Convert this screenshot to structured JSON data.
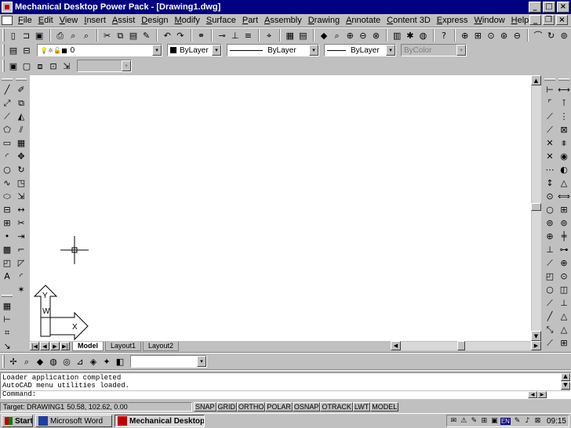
{
  "window": {
    "title": "Mechanical Desktop Power Pack - [Drawing1.dwg]",
    "minimize_glyph": "_",
    "maximize_glyph": "□",
    "close_glyph": "×",
    "mdi_minimize_glyph": "_",
    "mdi_restore_glyph": "❐",
    "mdi_close_glyph": "×"
  },
  "menu": {
    "items": [
      "File",
      "Edit",
      "View",
      "Insert",
      "Assist",
      "Design",
      "Modify",
      "Surface",
      "Part",
      "Assembly",
      "Drawing",
      "Annotate",
      "Content 3D",
      "Express",
      "Window",
      "Help"
    ]
  },
  "standard_toolbar": {
    "icons": [
      {
        "name": "new-icon",
        "glyph": "▯"
      },
      {
        "name": "open-icon",
        "glyph": "⊐"
      },
      {
        "name": "save-icon",
        "glyph": "▣"
      },
      {
        "name": "sep"
      },
      {
        "name": "print-icon",
        "glyph": "⎙"
      },
      {
        "name": "print-preview-icon",
        "glyph": "⌕"
      },
      {
        "name": "find-icon",
        "glyph": "⌕"
      },
      {
        "name": "sep"
      },
      {
        "name": "cut-icon",
        "glyph": "✂"
      },
      {
        "name": "copy-icon",
        "glyph": "⧉"
      },
      {
        "name": "paste-icon",
        "glyph": "▤"
      },
      {
        "name": "match-properties-icon",
        "glyph": "✎"
      },
      {
        "name": "sep"
      },
      {
        "name": "undo-icon",
        "glyph": "↶"
      },
      {
        "name": "redo-icon",
        "glyph": "↷"
      },
      {
        "name": "sep"
      },
      {
        "name": "hyperlink-icon",
        "glyph": "⚭"
      },
      {
        "name": "sep"
      },
      {
        "name": "snap-from-icon",
        "glyph": "⊸"
      },
      {
        "name": "ucs-icon",
        "glyph": "⊥"
      },
      {
        "name": "tracking-icon",
        "glyph": "≡"
      },
      {
        "name": "sep"
      },
      {
        "name": "distance-icon",
        "glyph": "⌖"
      },
      {
        "name": "sep"
      },
      {
        "name": "design-center-icon",
        "glyph": "▦"
      },
      {
        "name": "properties-icon",
        "glyph": "▤"
      },
      {
        "name": "sep"
      },
      {
        "name": "view-icon",
        "glyph": "◆"
      },
      {
        "name": "zoom-realtime-icon",
        "glyph": "⌕"
      },
      {
        "name": "zoom-window-icon",
        "glyph": "⊕"
      },
      {
        "name": "zoom-previous-icon",
        "glyph": "⊖"
      },
      {
        "name": "zoom-all-icon",
        "glyph": "⊗"
      },
      {
        "name": "sep"
      },
      {
        "name": "layer-icon",
        "glyph": "▥"
      },
      {
        "name": "linetype-icon",
        "glyph": "✱"
      },
      {
        "name": "color-icon",
        "glyph": "◍"
      },
      {
        "name": "sep"
      },
      {
        "name": "help-icon",
        "glyph": "?"
      },
      {
        "name": "sep"
      },
      {
        "name": "zoom-in-icon",
        "glyph": "⊕"
      },
      {
        "name": "zoom-extents-icon",
        "glyph": "⊞"
      },
      {
        "name": "zoom-center-icon",
        "glyph": "⊙"
      },
      {
        "name": "zoom-scale-icon",
        "glyph": "⊛"
      },
      {
        "name": "zoom-out-icon",
        "glyph": "⊖"
      },
      {
        "name": "sep"
      },
      {
        "name": "pan-icon",
        "glyph": "⌒"
      },
      {
        "name": "rotate-view-icon",
        "glyph": "↻"
      },
      {
        "name": "orbit-icon",
        "glyph": "⊚"
      }
    ]
  },
  "properties_toolbar": {
    "layer_value": "0",
    "color_value": "ByLayer",
    "linetype_value": "ByLayer",
    "lineweight_value": "ByLayer",
    "plotstyle_value": "ByColor",
    "layer_icons": "💡☼🔓■",
    "dropdown_glyph": "▾",
    "color_swatch": "#000000"
  },
  "left_toolbar": {
    "col1": [
      "line-icon",
      "construction-line-icon",
      "polyline-icon",
      "polygon-icon",
      "rectangle-icon",
      "arc-icon",
      "circle-icon",
      "spline-icon",
      "ellipse-icon",
      "insert-block-icon",
      "make-block-icon",
      "point-icon",
      "hatch-icon",
      "region-icon",
      "multiline-text-icon"
    ],
    "col1_glyphs": [
      "╱",
      "⤢",
      "⟋",
      "⬠",
      "▭",
      "◜",
      "○",
      "∿",
      "⬭",
      "⊟",
      "⊞",
      "•",
      "▩",
      "◰",
      "A"
    ],
    "col2": [
      "erase-icon",
      "copy-object-icon",
      "mirror-icon",
      "offset-icon",
      "array-icon",
      "move-icon",
      "rotate-icon",
      "scale-icon",
      "stretch-icon",
      "lengthen-icon",
      "trim-icon",
      "extend-icon",
      "break-icon",
      "chamfer-icon",
      "fillet-icon",
      "explode-icon"
    ],
    "col2_glyphs": [
      "✐",
      "⧉",
      "◭",
      "⫽",
      "▦",
      "✥",
      "↻",
      "◳",
      "⇲",
      "↔",
      "✂",
      "⇥",
      "⌐",
      "◸",
      "◜",
      "✶"
    ],
    "lower": [
      "table-icon",
      "dimension-icon",
      "grid-icon",
      "leader-icon"
    ],
    "lower_glyphs": [
      "▦",
      "⊢",
      "⌗",
      "↘"
    ]
  },
  "right_toolbar": {
    "col1": [
      "dim-linear-icon",
      "dim-aligned-icon",
      "dim-ordinate-icon",
      "dim-radius-icon",
      "dim-diameter-icon",
      "dim-angular-icon",
      "dim-quick-icon",
      "dim-baseline-icon",
      "dim-continue-icon",
      "leader-dim-icon",
      "tolerance-icon",
      "center-mark-icon",
      "dim-edit-icon",
      "dim-text-edit-icon",
      "dim-update-icon",
      "dim-style-icon",
      "surface-icon",
      "sphere-icon",
      "cone-icon",
      "cylinder-icon",
      "torus-icon",
      "wedge-icon",
      "extrude-icon",
      "revolve-icon",
      "delete-dim-icon",
      "magnet-icon"
    ],
    "col1_glyphs": [
      "⊢",
      "⌜",
      "⟋",
      "⟋",
      "✕",
      "✕",
      "⋯",
      "↕",
      "⊙",
      "○",
      "⊚",
      "⊕",
      "⊥",
      "⟋",
      "◰",
      "○",
      "⟋",
      "╱",
      "⤡",
      "⟋",
      "✕",
      "∩",
      "",
      "",
      "",
      ""
    ],
    "col2": [
      "dim-horizontal-icon",
      "dim-vertical-icon",
      "dim-chain-icon",
      "dim-datum-icon",
      "dim-parallel-icon",
      "dim-circle-icon",
      "dim-rotate-icon",
      "dim-triangle-icon",
      "dim-width-icon",
      "dim-hole-icon",
      "dim-radial-icon",
      "dim-break-icon",
      "dim-sym-icon",
      "dim-axis-icon",
      "dim-center-icon",
      "dim-slot-icon",
      "dim-line-icon",
      "dim-angle-icon",
      "dim-arrow-icon",
      "dim-multi-icon",
      "dim-cross-icon"
    ],
    "col2_glyphs": [
      "⟷",
      "⊺",
      "⋮",
      "⊠",
      "⩨",
      "◉",
      "◐",
      "△",
      "⟺",
      "⊞",
      "⊚",
      "╪",
      "⊶",
      "⊕",
      "⊙",
      "◫",
      "⊥",
      "△",
      "△",
      "⊞",
      "⊠"
    ]
  },
  "layout_tabs": {
    "nav": [
      "|◀",
      "◀",
      "▶",
      "▶|"
    ],
    "tabs": [
      "Model",
      "Layout1",
      "Layout2"
    ],
    "active": "Model",
    "scroll_left": "◀",
    "scroll_right": "▶",
    "scroll_up": "▲",
    "scroll_down": "▼"
  },
  "ucs": {
    "y_label": "Y",
    "w_label": "W",
    "x_label": "X"
  },
  "bottom_toolbar": {
    "icons": [
      "snap-icon",
      "zoom-window-icon-2",
      "view-icon-2",
      "render-icon",
      "hide-icon",
      "shade-icon",
      "material-icon",
      "light-icon",
      "scene-icon"
    ],
    "glyphs": [
      "✢",
      "⌕",
      "◆",
      "◍",
      "◎",
      "⊿",
      "◈",
      "✦",
      "◧"
    ],
    "combo_value": ""
  },
  "command": {
    "history": [
      "Loader application completed",
      "AutoCAD menu utilities loaded."
    ],
    "prompt": "Command:",
    "input": ""
  },
  "status": {
    "target": "Target: DRAWING1",
    "coords": "50.58, 102.62, 0.00",
    "modes": [
      "SNAP",
      "GRID",
      "ORTHO",
      "POLAR",
      "OSNAP",
      "OTRACK",
      "LWT",
      "MODEL"
    ]
  },
  "taskbar": {
    "start_label": "Start",
    "tasks": [
      {
        "label": "Microsoft Word",
        "active": false
      },
      {
        "label": "Mechanical Desktop ...",
        "active": true
      }
    ],
    "tray_icons": [
      "✉",
      "⚠",
      "✎",
      "⊞",
      "▣"
    ],
    "lang": "EN",
    "tray_icons_2": [
      "✎",
      "♪",
      "⊠"
    ],
    "time": "09:15"
  }
}
